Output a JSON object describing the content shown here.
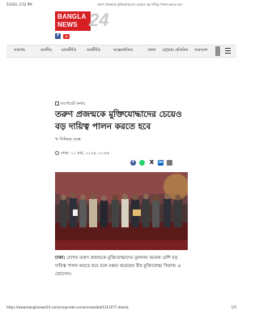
{
  "print_header": {
    "date": "5/3/24, 2:52 PM",
    "page_title": "তরুণ প্রজন্মকে মুক্তিযোদ্ধাদের চেয়েও বড় দায়িত্ব পালন করতে হবে"
  },
  "site": {
    "logo_line1": "BANGLA",
    "logo_line2": "NEWS",
    "logo_number": "24",
    "brand_color": "#d71f26"
  },
  "social": {
    "facebook_glyph": "f",
    "youtube_icon": "youtube-icon"
  },
  "nav": {
    "items": [
      "সর্বশেষ",
      "জাতীয়",
      "রাজনীতি",
      "অর্থনীতি",
      "আন্তর্জাতিক",
      "খেলা",
      "চট্টগ্রাম প্রতিদিন",
      "সারাদেশ"
    ]
  },
  "article": {
    "category": "কর্পোরেট কর্নার",
    "headline": "তরুণ প্রজন্মকে মুক্তিযোদ্ধাদের চেয়েও বড় দায়িত্ব পালন করতে হবে",
    "byline": "সিনিয়র ডেস্ক",
    "dateline": "ঢাকা: ১২ মার্চ, ২০২৪ ০০:৪৬",
    "share": {
      "facebook": "f",
      "x": "X",
      "linkedin": "in"
    },
    "body_lead": "ঢাকা:",
    "body_text": " দেশের তরুণ প্রজন্মকে মুক্তিযোদ্ধাদের তুলনায় অনেক বেশি বড় দায়িত্ব পালন করতে হবে বলে মন্তব্য করেছেন বীর মুক্তিযোদ্ধা সিরাজ এ জোসেন।"
  },
  "print_footer": {
    "url": "https://www.banglanews24.com/corporate-corner/news/bd/1311077.details",
    "page": "1/5"
  }
}
